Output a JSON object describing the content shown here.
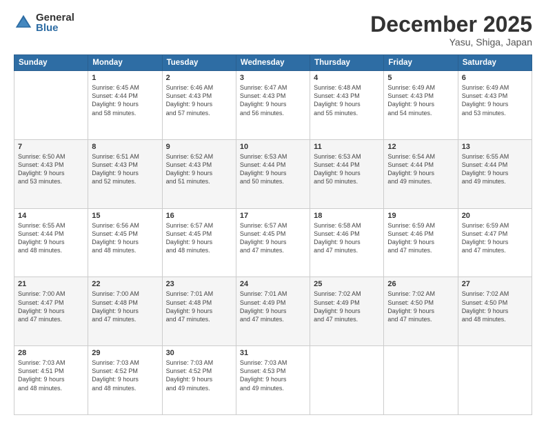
{
  "header": {
    "logo_general": "General",
    "logo_blue": "Blue",
    "month": "December 2025",
    "location": "Yasu, Shiga, Japan"
  },
  "weekdays": [
    "Sunday",
    "Monday",
    "Tuesday",
    "Wednesday",
    "Thursday",
    "Friday",
    "Saturday"
  ],
  "weeks": [
    [
      {
        "day": "",
        "info": ""
      },
      {
        "day": "1",
        "info": "Sunrise: 6:45 AM\nSunset: 4:44 PM\nDaylight: 9 hours\nand 58 minutes."
      },
      {
        "day": "2",
        "info": "Sunrise: 6:46 AM\nSunset: 4:43 PM\nDaylight: 9 hours\nand 57 minutes."
      },
      {
        "day": "3",
        "info": "Sunrise: 6:47 AM\nSunset: 4:43 PM\nDaylight: 9 hours\nand 56 minutes."
      },
      {
        "day": "4",
        "info": "Sunrise: 6:48 AM\nSunset: 4:43 PM\nDaylight: 9 hours\nand 55 minutes."
      },
      {
        "day": "5",
        "info": "Sunrise: 6:49 AM\nSunset: 4:43 PM\nDaylight: 9 hours\nand 54 minutes."
      },
      {
        "day": "6",
        "info": "Sunrise: 6:49 AM\nSunset: 4:43 PM\nDaylight: 9 hours\nand 53 minutes."
      }
    ],
    [
      {
        "day": "7",
        "info": "Sunrise: 6:50 AM\nSunset: 4:43 PM\nDaylight: 9 hours\nand 53 minutes."
      },
      {
        "day": "8",
        "info": "Sunrise: 6:51 AM\nSunset: 4:43 PM\nDaylight: 9 hours\nand 52 minutes."
      },
      {
        "day": "9",
        "info": "Sunrise: 6:52 AM\nSunset: 4:43 PM\nDaylight: 9 hours\nand 51 minutes."
      },
      {
        "day": "10",
        "info": "Sunrise: 6:53 AM\nSunset: 4:44 PM\nDaylight: 9 hours\nand 50 minutes."
      },
      {
        "day": "11",
        "info": "Sunrise: 6:53 AM\nSunset: 4:44 PM\nDaylight: 9 hours\nand 50 minutes."
      },
      {
        "day": "12",
        "info": "Sunrise: 6:54 AM\nSunset: 4:44 PM\nDaylight: 9 hours\nand 49 minutes."
      },
      {
        "day": "13",
        "info": "Sunrise: 6:55 AM\nSunset: 4:44 PM\nDaylight: 9 hours\nand 49 minutes."
      }
    ],
    [
      {
        "day": "14",
        "info": "Sunrise: 6:55 AM\nSunset: 4:44 PM\nDaylight: 9 hours\nand 48 minutes."
      },
      {
        "day": "15",
        "info": "Sunrise: 6:56 AM\nSunset: 4:45 PM\nDaylight: 9 hours\nand 48 minutes."
      },
      {
        "day": "16",
        "info": "Sunrise: 6:57 AM\nSunset: 4:45 PM\nDaylight: 9 hours\nand 48 minutes."
      },
      {
        "day": "17",
        "info": "Sunrise: 6:57 AM\nSunset: 4:45 PM\nDaylight: 9 hours\nand 47 minutes."
      },
      {
        "day": "18",
        "info": "Sunrise: 6:58 AM\nSunset: 4:46 PM\nDaylight: 9 hours\nand 47 minutes."
      },
      {
        "day": "19",
        "info": "Sunrise: 6:59 AM\nSunset: 4:46 PM\nDaylight: 9 hours\nand 47 minutes."
      },
      {
        "day": "20",
        "info": "Sunrise: 6:59 AM\nSunset: 4:47 PM\nDaylight: 9 hours\nand 47 minutes."
      }
    ],
    [
      {
        "day": "21",
        "info": "Sunrise: 7:00 AM\nSunset: 4:47 PM\nDaylight: 9 hours\nand 47 minutes."
      },
      {
        "day": "22",
        "info": "Sunrise: 7:00 AM\nSunset: 4:48 PM\nDaylight: 9 hours\nand 47 minutes."
      },
      {
        "day": "23",
        "info": "Sunrise: 7:01 AM\nSunset: 4:48 PM\nDaylight: 9 hours\nand 47 minutes."
      },
      {
        "day": "24",
        "info": "Sunrise: 7:01 AM\nSunset: 4:49 PM\nDaylight: 9 hours\nand 47 minutes."
      },
      {
        "day": "25",
        "info": "Sunrise: 7:02 AM\nSunset: 4:49 PM\nDaylight: 9 hours\nand 47 minutes."
      },
      {
        "day": "26",
        "info": "Sunrise: 7:02 AM\nSunset: 4:50 PM\nDaylight: 9 hours\nand 47 minutes."
      },
      {
        "day": "27",
        "info": "Sunrise: 7:02 AM\nSunset: 4:50 PM\nDaylight: 9 hours\nand 48 minutes."
      }
    ],
    [
      {
        "day": "28",
        "info": "Sunrise: 7:03 AM\nSunset: 4:51 PM\nDaylight: 9 hours\nand 48 minutes."
      },
      {
        "day": "29",
        "info": "Sunrise: 7:03 AM\nSunset: 4:52 PM\nDaylight: 9 hours\nand 48 minutes."
      },
      {
        "day": "30",
        "info": "Sunrise: 7:03 AM\nSunset: 4:52 PM\nDaylight: 9 hours\nand 49 minutes."
      },
      {
        "day": "31",
        "info": "Sunrise: 7:03 AM\nSunset: 4:53 PM\nDaylight: 9 hours\nand 49 minutes."
      },
      {
        "day": "",
        "info": ""
      },
      {
        "day": "",
        "info": ""
      },
      {
        "day": "",
        "info": ""
      }
    ]
  ]
}
